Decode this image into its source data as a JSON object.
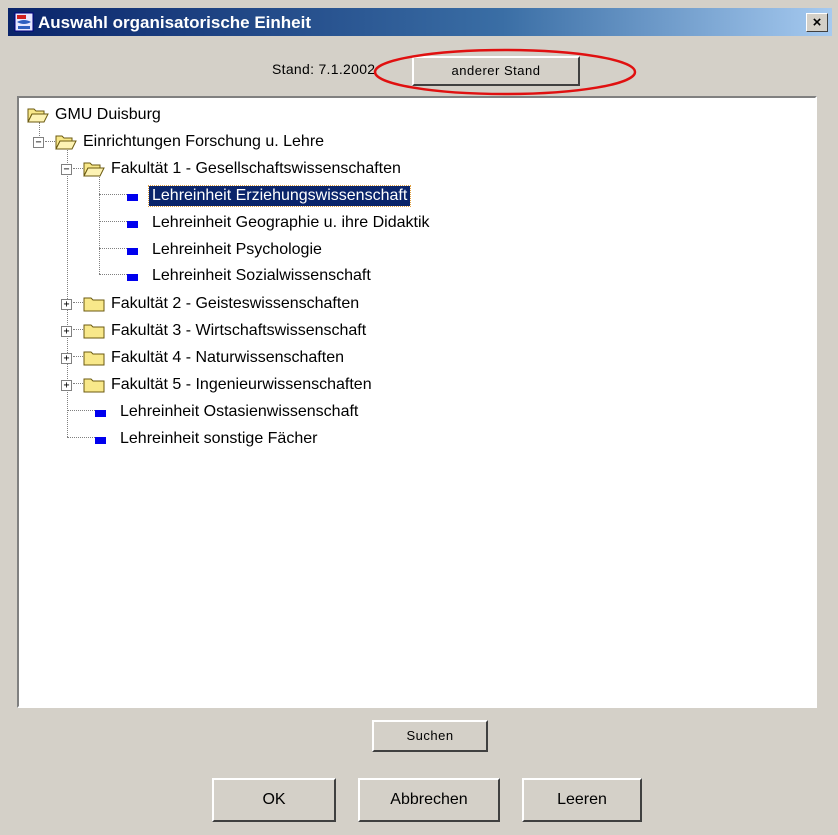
{
  "window": {
    "title": "Auswahl organisatorische Einheit",
    "close_label": "×"
  },
  "stand": {
    "label": "Stand: 7.1.2002",
    "button_label": "anderer Stand",
    "highlight_color": "#e01010"
  },
  "tree": {
    "root": {
      "label": "GMU Duisburg"
    },
    "group": {
      "label": "Einrichtungen Forschung u. Lehre",
      "toggle": "−"
    },
    "faculty1": {
      "label": "Fakultät 1 - Gesellschaftswissenschaften",
      "toggle": "−"
    },
    "faculty1_children": [
      {
        "label": "Lehreinheit Erziehungswissenschaft",
        "selected": true
      },
      {
        "label": "Lehreinheit Geographie u. ihre Didaktik"
      },
      {
        "label": "Lehreinheit Psychologie"
      },
      {
        "label": "Lehreinheit Sozialwissenschaft"
      }
    ],
    "faculties_collapsed": [
      {
        "label": "Fakultät 2 - Geisteswissenschaften",
        "toggle": "+"
      },
      {
        "label": "Fakultät 3 - Wirtschaftswissenschaft",
        "toggle": "+"
      },
      {
        "label": "Fakultät 4 - Naturwissenschaften",
        "toggle": "+"
      },
      {
        "label": "Fakultät 5 - Ingenieurwissenschaften",
        "toggle": "+"
      }
    ],
    "units": [
      {
        "label": "Lehreinheit Ostasienwissenschaft"
      },
      {
        "label": "Lehreinheit sonstige Fächer"
      }
    ],
    "selection_color": "#0a246a",
    "leaf_color": "#0000ee",
    "folder_color": "#f8e88a"
  },
  "buttons": {
    "search": "Suchen",
    "ok": "OK",
    "cancel": "Abbrechen",
    "clear": "Leeren"
  }
}
